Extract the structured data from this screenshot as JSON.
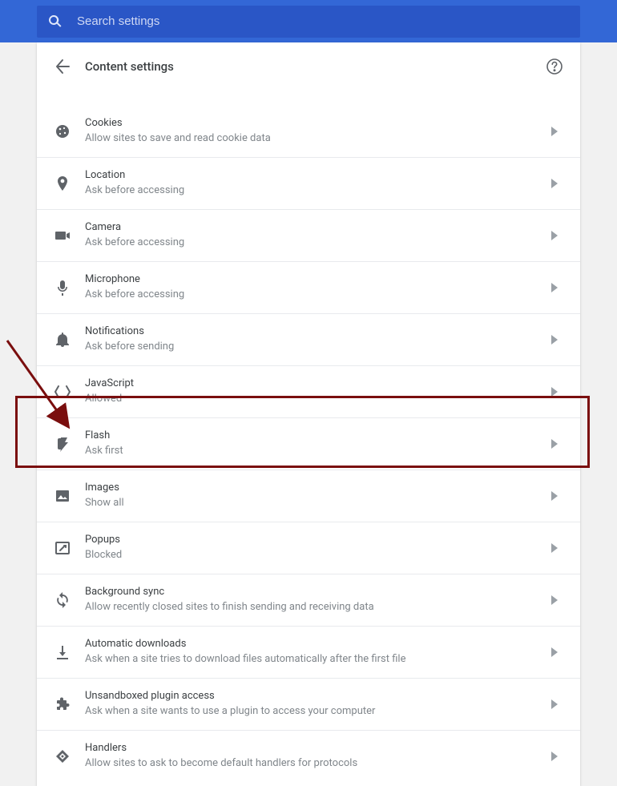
{
  "search": {
    "placeholder": "Search settings"
  },
  "header": {
    "title": "Content settings"
  },
  "rows": [
    {
      "icon": "cookie-icon",
      "title": "Cookies",
      "sub": "Allow sites to save and read cookie data"
    },
    {
      "icon": "location-icon",
      "title": "Location",
      "sub": "Ask before accessing"
    },
    {
      "icon": "camera-icon",
      "title": "Camera",
      "sub": "Ask before accessing"
    },
    {
      "icon": "microphone-icon",
      "title": "Microphone",
      "sub": "Ask before accessing"
    },
    {
      "icon": "notifications-icon",
      "title": "Notifications",
      "sub": "Ask before sending"
    },
    {
      "icon": "javascript-icon",
      "title": "JavaScript",
      "sub": "Allowed"
    },
    {
      "icon": "flash-icon",
      "title": "Flash",
      "sub": "Ask first"
    },
    {
      "icon": "images-icon",
      "title": "Images",
      "sub": "Show all"
    },
    {
      "icon": "popups-icon",
      "title": "Popups",
      "sub": "Blocked"
    },
    {
      "icon": "sync-icon",
      "title": "Background sync",
      "sub": "Allow recently closed sites to finish sending and receiving data"
    },
    {
      "icon": "download-icon",
      "title": "Automatic downloads",
      "sub": "Ask when a site tries to download files automatically after the first file"
    },
    {
      "icon": "plugin-icon",
      "title": "Unsandboxed plugin access",
      "sub": "Ask when a site wants to use a plugin to access your computer"
    },
    {
      "icon": "handlers-icon",
      "title": "Handlers",
      "sub": "Allow sites to ask to become default handlers for protocols"
    }
  ]
}
